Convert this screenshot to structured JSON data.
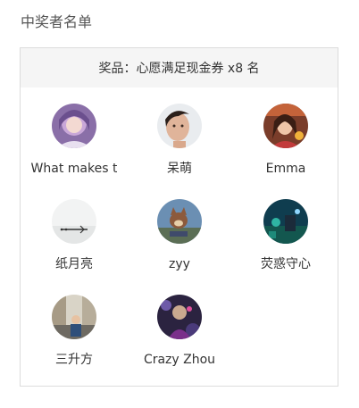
{
  "section_title": "中奖者名单",
  "prize": {
    "label": "奖品：心愿满足现金券 x8 名"
  },
  "winners": [
    {
      "name": "What makes t",
      "avatar": "purple-hair-girl-avatar"
    },
    {
      "name": "呆萌",
      "avatar": "man-face-avatar"
    },
    {
      "name": "Emma",
      "avatar": "woman-photo-avatar"
    },
    {
      "name": "纸月亮",
      "avatar": "sketch-avatar"
    },
    {
      "name": "zyy",
      "avatar": "cartoon-cat-avatar"
    },
    {
      "name": "荧惑守心",
      "avatar": "blue-night-scene-avatar"
    },
    {
      "name": "三升方",
      "avatar": "street-scene-avatar"
    },
    {
      "name": "Crazy Zhou",
      "avatar": "dark-purple-figure-avatar"
    }
  ]
}
